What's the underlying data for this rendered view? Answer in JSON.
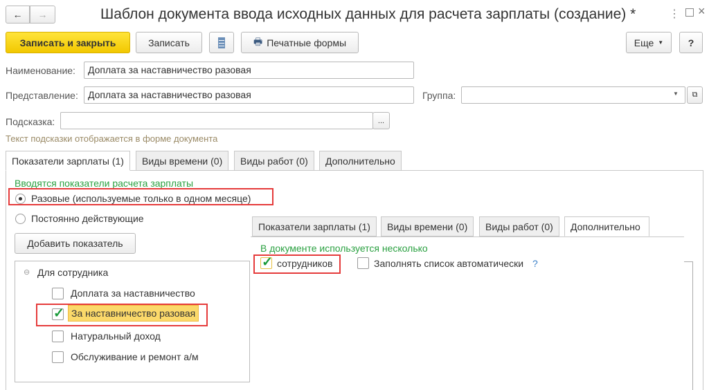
{
  "window": {
    "title": "Шаблон документа ввода исходных данных для расчета зарплаты (создание) *"
  },
  "toolbar": {
    "save_close": "Записать и закрыть",
    "save": "Записать",
    "print_forms": "Печатные формы",
    "more": "Еще",
    "help": "?"
  },
  "form": {
    "name_label": "Наименование:",
    "name_value": "Доплата за наставничество разовая",
    "repr_label": "Представление:",
    "repr_value": "Доплата за наставничество разовая",
    "group_label": "Группа:",
    "group_value": "",
    "hint_label": "Подсказка:",
    "hint_value": "",
    "hint_note": "Текст подсказки отображается в форме документа"
  },
  "tabs": [
    "Показатели зарплаты (1)",
    "Виды времени (0)",
    "Виды работ (0)",
    "Дополнительно"
  ],
  "main": {
    "section_title": "Вводятся показатели расчета зарплаты",
    "radio_once": "Разовые (используемые только в одном месяце)",
    "radio_permanent": "Постоянно действующие",
    "add_indicator": "Добавить показатель",
    "group_name": "Для сотрудника",
    "items": [
      {
        "label": "Доплата за наставничество",
        "checked": false
      },
      {
        "label": "За наставничество разовая",
        "checked": true
      },
      {
        "label": "Натуральный доход",
        "checked": false
      },
      {
        "label": "Обслуживание и ремонт а/м",
        "checked": false
      }
    ]
  },
  "overlay": {
    "tabs": [
      "Показатели зарплаты (1)",
      "Виды времени (0)",
      "Виды работ (0)",
      "Дополнительно"
    ],
    "section_title": "В документе используется несколько",
    "employees_label": "сотрудников",
    "autofill_label": "Заполнять список автоматически",
    "help": "?"
  }
}
